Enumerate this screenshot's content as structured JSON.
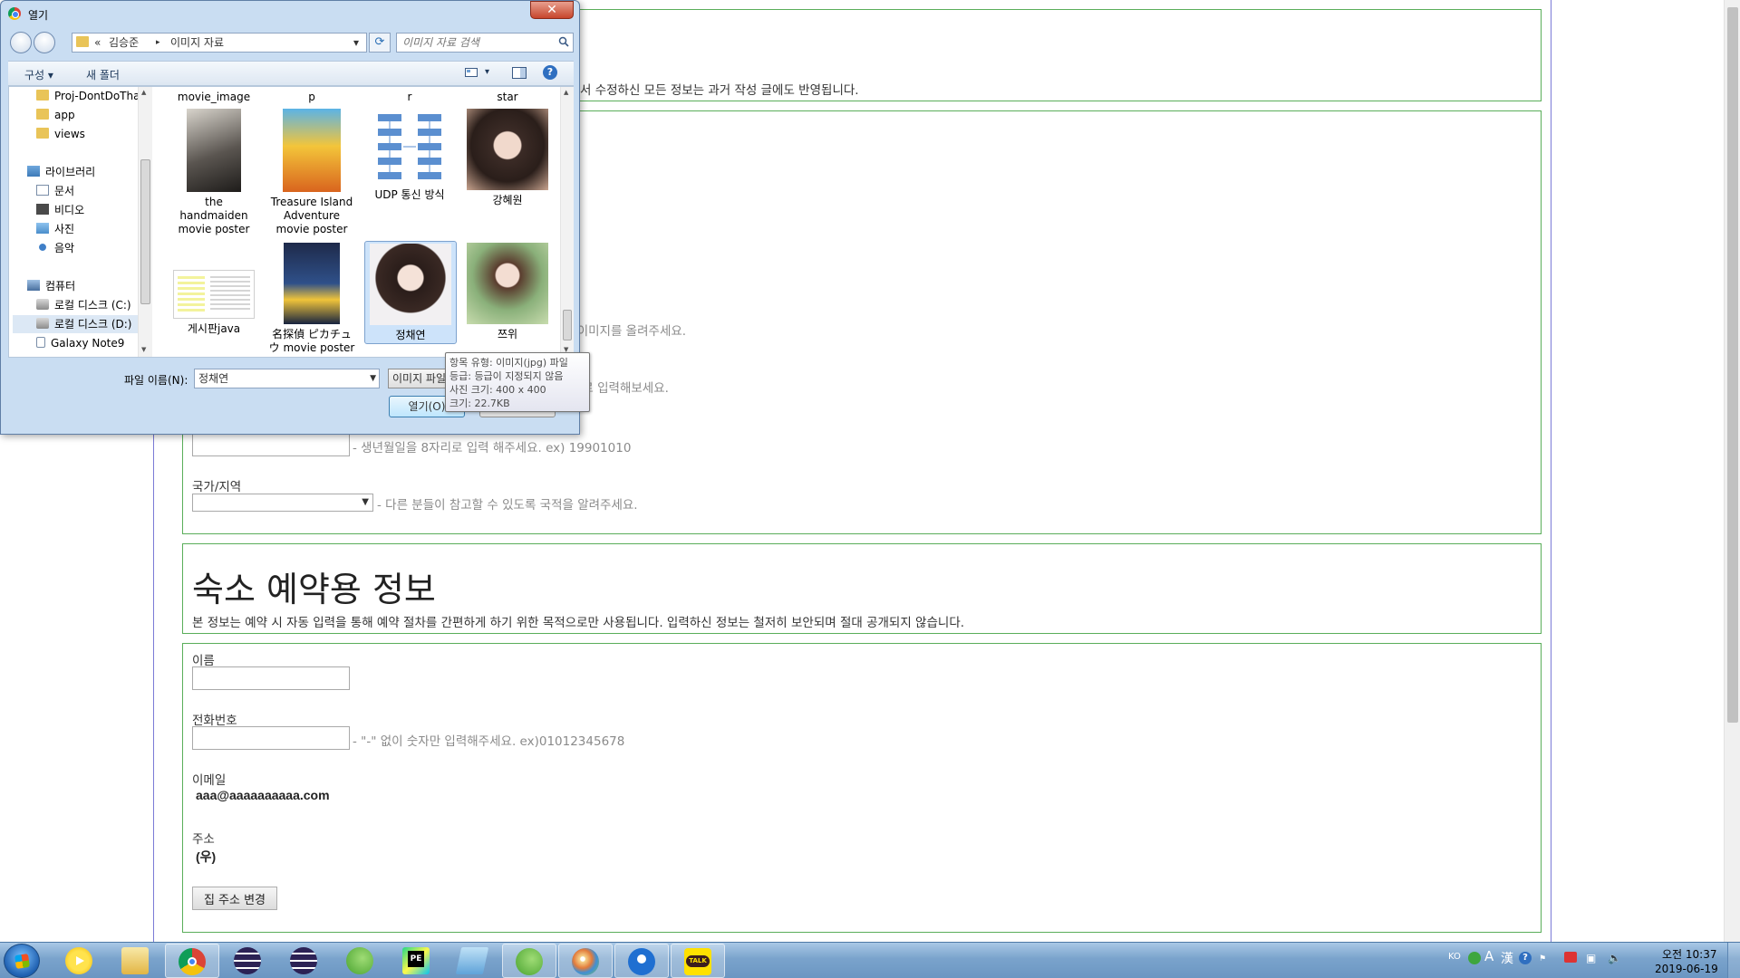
{
  "page": {
    "top_desc": "서 수정하신 모든 정보는 과거 작성 글에도 반영됩니다.",
    "hint_photo": "는 이미지를 올려주세요.",
    "hint_name2": "으로 입력해보세요.",
    "hint_birth": "- 생년월일을 8자리로 입력 해주세요. ex) 19901010",
    "country_label": "국가/지역",
    "hint_country": "- 다른 분들이 참고할 수 있도록 국적을 알려주세요.",
    "select_arrow": "▼",
    "booking_title": "숙소 예약용 정보",
    "booking_desc": "본 정보는 예약 시 자동 입력을 통해 예약 절차를 간편하게 하기 위한 목적으로만 사용됩니다. 입력하신 정보는 철저히 보안되며 절대 공개되지 않습니다.",
    "name_label": "이름",
    "phone_label": "전화번호",
    "hint_phone": "- \"-\" 없이 숫자만 입력해주세요. ex)01012345678",
    "email_label": "이메일",
    "email_value": "aaa@aaaaaaaaaa.com",
    "address_label": "주소",
    "zip_value": "(우)",
    "address_button": "집 주소 변경"
  },
  "dialog": {
    "title": "열기",
    "close": "✕",
    "address": {
      "chevron": "«",
      "crumb1": "김승준",
      "sep": "▸",
      "crumb2": "이미지 자료",
      "dropdown": "▾"
    },
    "refresh_icon": "⟳",
    "search_placeholder": "이미지 자료 검색",
    "toolbar": {
      "organize": "구성 ▾",
      "new_folder": "새 폴더",
      "view_dd": "▾",
      "help": "?"
    },
    "tree": [
      {
        "label": "Proj-DontDoTha",
        "icon": "folder-icon"
      },
      {
        "label": "app",
        "icon": "folder-icon"
      },
      {
        "label": "views",
        "icon": "folder-icon"
      },
      {
        "label": "라이브러리",
        "icon": "library-icon"
      },
      {
        "label": "문서",
        "icon": "document-icon"
      },
      {
        "label": "비디오",
        "icon": "video-icon"
      },
      {
        "label": "사진",
        "icon": "picture-icon"
      },
      {
        "label": "음악",
        "icon": "music-icon"
      },
      {
        "label": "컴퓨터",
        "icon": "computer-icon"
      },
      {
        "label": "로컬 디스크 (C:)",
        "icon": "disk-icon"
      },
      {
        "label": "로컬 디스크 (D:)",
        "icon": "disk-icon"
      },
      {
        "label": "Galaxy Note9",
        "icon": "phone-icon"
      }
    ],
    "tree_arrow_up": "▲",
    "tree_arrow_down": "▼",
    "top_row_labels": [
      "movie_image",
      "p",
      "r",
      "star"
    ],
    "files": [
      {
        "label": "the handmaiden movie poster"
      },
      {
        "label": "Treasure Island Adventure movie poster"
      },
      {
        "label": "UDP 통신 방식"
      },
      {
        "label": "강혜원"
      },
      {
        "label": "게시판java"
      },
      {
        "label": "名探偵 ピカチュウ movie poster"
      },
      {
        "label": "정채연"
      },
      {
        "label": "쯔위"
      }
    ],
    "file_name_label": "파일 이름(N):",
    "file_name_value": "정채연",
    "file_type_value": "이미지 파일",
    "open_button": "열기(O)",
    "tooltip": {
      "line1": "항목 유형: 이미지(jpg) 파일",
      "line2": "등급: 등급이 지정되지 않음",
      "line3": "사진 크기: 400 x 400",
      "line4": "크기: 22.7KB"
    }
  },
  "taskbar": {
    "apps": [
      "media-player",
      "file-explorer",
      "chrome",
      "eclipse",
      "eclipse-2",
      "spring-tool-suite",
      "pycharm",
      "notepad",
      "spring-tool-suite-2",
      "paint",
      "maps-pin",
      "kakaotalk"
    ],
    "pycharm_label": "PE",
    "kakao_label": "TALK",
    "tray": {
      "lang": "KO",
      "ime_a": "A",
      "ime_han": "漢",
      "help": "?",
      "flag": "⚑",
      "volume": "🔈",
      "network": "▣"
    },
    "time": "오전 10:37",
    "date": "2019-06-19"
  }
}
